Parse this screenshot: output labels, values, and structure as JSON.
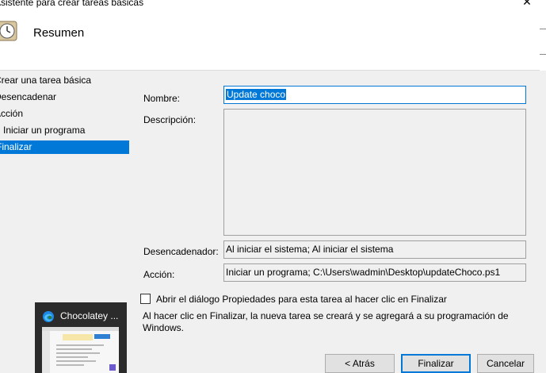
{
  "window": {
    "title": "Asistente para crear tareas básicas",
    "close_glyph": "✕"
  },
  "header": {
    "icon": "clock-icon",
    "title": "Resumen"
  },
  "steps": [
    {
      "label": "Crear una tarea básica",
      "active": false
    },
    {
      "label": "Desencadenar",
      "active": false
    },
    {
      "label": "Acción",
      "active": false
    },
    {
      "label": "Iniciar un programa",
      "active": false
    },
    {
      "label": "Finalizar",
      "active": true
    }
  ],
  "form": {
    "name_label": "Nombre:",
    "name_value": "Update choco",
    "description_label": "Descripción:",
    "description_value": "",
    "trigger_label": "Desencadenador:",
    "trigger_value": "Al iniciar el sistema; Al iniciar el sistema",
    "action_label": "Acción:",
    "action_value": "Iniciar un programa; C:\\Users\\wadmin\\Desktop\\updateChoco.ps1"
  },
  "open_properties": {
    "label": "Abrir el diálogo Propiedades para esta tarea al hacer clic en Finalizar",
    "checked": false
  },
  "info_text": "Al hacer clic en Finalizar, la nueva tarea se creará y se agregará a su programación de Windows.",
  "buttons": {
    "back": "< Atrás",
    "finish": "Finalizar",
    "cancel": "Cancelar"
  },
  "taskbar_preview": {
    "icon": "edge-icon",
    "label": "Chocolatey ..."
  },
  "colors": {
    "accent": "#0078d7",
    "background": "#f0f0f0"
  }
}
